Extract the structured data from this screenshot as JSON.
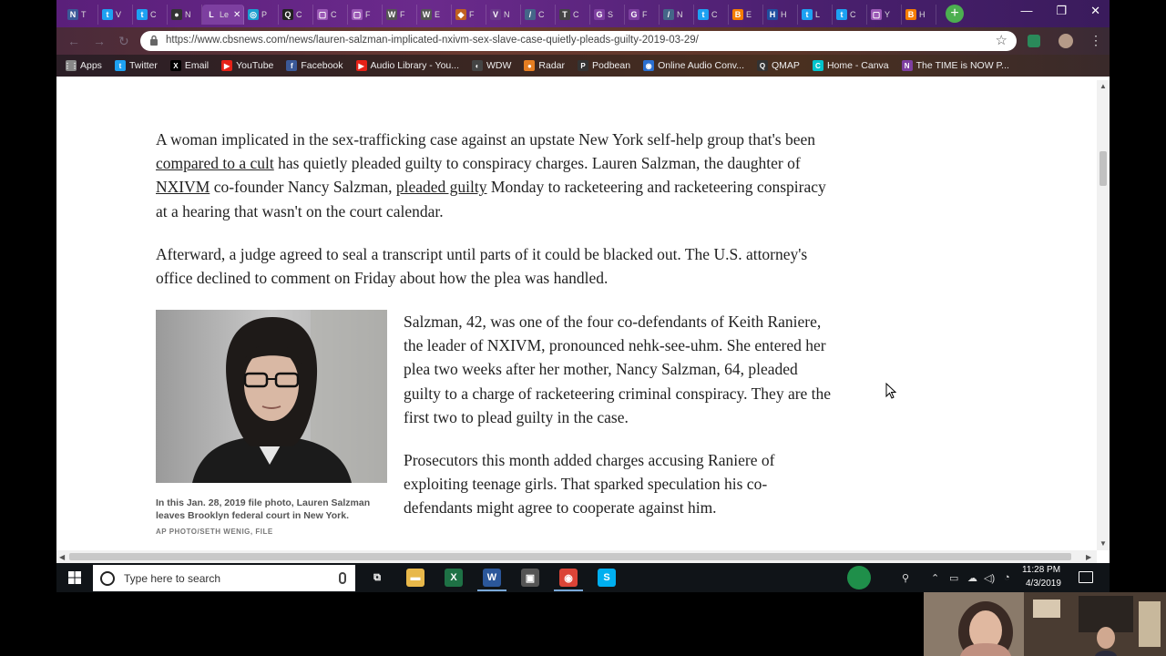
{
  "browser": {
    "tabs": [
      {
        "icon": "N",
        "color": "#3b5998",
        "label": "T"
      },
      {
        "icon": "t",
        "color": "#1da1f2",
        "label": "V"
      },
      {
        "icon": "t",
        "color": "#1da1f2",
        "label": "C"
      },
      {
        "icon": "●",
        "color": "#333333",
        "label": "N"
      },
      {
        "icon": "L",
        "color": "#7d3fa0",
        "label": "Le",
        "active": true
      },
      {
        "icon": "◎",
        "color": "#1a9fd0",
        "label": "P"
      },
      {
        "icon": "Q",
        "color": "#222222",
        "label": "C"
      },
      {
        "icon": "▢",
        "color": "#9b59b6",
        "label": "C"
      },
      {
        "icon": "▢",
        "color": "#9b59b6",
        "label": "F"
      },
      {
        "icon": "W",
        "color": "#555555",
        "label": "F"
      },
      {
        "icon": "W",
        "color": "#555555",
        "label": "E"
      },
      {
        "icon": "◆",
        "color": "#c06020",
        "label": "F"
      },
      {
        "icon": "V",
        "color": "#6a3a8a",
        "label": "N"
      },
      {
        "icon": "/",
        "color": "#446688",
        "label": "C"
      },
      {
        "icon": "T",
        "color": "#444444",
        "label": "C"
      },
      {
        "icon": "G",
        "color": "#7d3fa0",
        "label": "S"
      },
      {
        "icon": "G",
        "color": "#7d3fa0",
        "label": "F"
      },
      {
        "icon": "/",
        "color": "#446688",
        "label": "N"
      },
      {
        "icon": "t",
        "color": "#1da1f2",
        "label": "C"
      },
      {
        "icon": "B",
        "color": "#f57d00",
        "label": "E"
      },
      {
        "icon": "H",
        "color": "#2050a0",
        "label": "H"
      },
      {
        "icon": "t",
        "color": "#1da1f2",
        "label": "L"
      },
      {
        "icon": "t",
        "color": "#1da1f2",
        "label": "C"
      },
      {
        "icon": "▢",
        "color": "#9b59b6",
        "label": "Y"
      },
      {
        "icon": "B",
        "color": "#f57d00",
        "label": "H"
      }
    ],
    "active_tab_close": "✕",
    "new_tab": "+",
    "window_controls": {
      "minimize": "—",
      "restore": "❐",
      "close": "✕"
    },
    "url": "https://www.cbsnews.com/news/lauren-salzman-implicated-nxivm-sex-slave-case-quietly-pleads-guilty-2019-03-29/",
    "star": "☆",
    "back": "←",
    "forward": "→",
    "reload": "↻",
    "menu": "⋮",
    "bookmarks": [
      {
        "label": "Apps",
        "icon": "⋮⋮",
        "color": "#888888"
      },
      {
        "label": "Twitter",
        "icon": "t",
        "color": "#1da1f2"
      },
      {
        "label": "Email",
        "icon": "X",
        "color": "#000000"
      },
      {
        "label": "YouTube",
        "icon": "▶",
        "color": "#e62117"
      },
      {
        "label": "Facebook",
        "icon": "f",
        "color": "#3b5998"
      },
      {
        "label": "Audio Library - You...",
        "icon": "▶",
        "color": "#e62117"
      },
      {
        "label": "WDW",
        "icon": "◐",
        "color": "#444444"
      },
      {
        "label": "Radar",
        "icon": "●",
        "color": "#e67e22"
      },
      {
        "label": "Podbean",
        "icon": "P",
        "color": "#333333"
      },
      {
        "label": "Online Audio Conv...",
        "icon": "◉",
        "color": "#2a6fd0"
      },
      {
        "label": "QMAP",
        "icon": "Q",
        "color": "#333333"
      },
      {
        "label": "Home - Canva",
        "icon": "C",
        "color": "#00c4cc"
      },
      {
        "label": "The TIME is NOW P...",
        "icon": "N",
        "color": "#7d3fa0"
      }
    ]
  },
  "article": {
    "p1": {
      "t1": "A woman implicated in the sex-trafficking case against an upstate New York self-help group that's been ",
      "link1": "compared to a cult",
      "t2": " has quietly pleaded guilty to conspiracy charges. Lauren Salzman, the daughter of ",
      "link2": "NXIVM",
      "t3": " co-founder Nancy Salzman, ",
      "link3": "pleaded guilty",
      "t4": " Monday to racketeering and racketeering conspiracy at a hearing that wasn't on the court calendar."
    },
    "p2": "Afterward, a judge agreed to seal a transcript until parts of it could be blacked out. The U.S. attorney's office declined to comment on Friday about how the plea was handled.",
    "p3": "Salzman, 42, was one of the four co-defendants of Keith Raniere, the leader of NXIVM, pronounced nehk-see-uhm. She entered her plea two weeks after her mother, Nancy Salzman, 64, pleaded guilty to a charge of racketeering criminal conspiracy. They are the first two to plead guilty in the case.",
    "p4": "Prosecutors this month added charges accusing Raniere of exploiting teenage girls. That sparked speculation his co-defendants might agree to cooperate against him.",
    "caption": "In this Jan. 28, 2019 file photo, Lauren Salzman leaves Brooklyn federal court in New York.",
    "credit": "AP PHOTO/SETH WENIG, FILE"
  },
  "taskbar": {
    "search_placeholder": "Type here to search",
    "apps": [
      {
        "name": "task-view",
        "glyph": "⧉",
        "color": "#101418"
      },
      {
        "name": "file-explorer",
        "glyph": "▬",
        "color": "#e8b84a"
      },
      {
        "name": "excel",
        "glyph": "X",
        "color": "#1e7145"
      },
      {
        "name": "word",
        "glyph": "W",
        "color": "#2b579a"
      },
      {
        "name": "store",
        "glyph": "▣",
        "color": "#555555"
      },
      {
        "name": "chrome",
        "glyph": "◉",
        "color": "#db4437"
      },
      {
        "name": "skype",
        "glyph": "S",
        "color": "#00aff0"
      }
    ],
    "time": "11:28 PM",
    "date": "4/3/2019"
  }
}
